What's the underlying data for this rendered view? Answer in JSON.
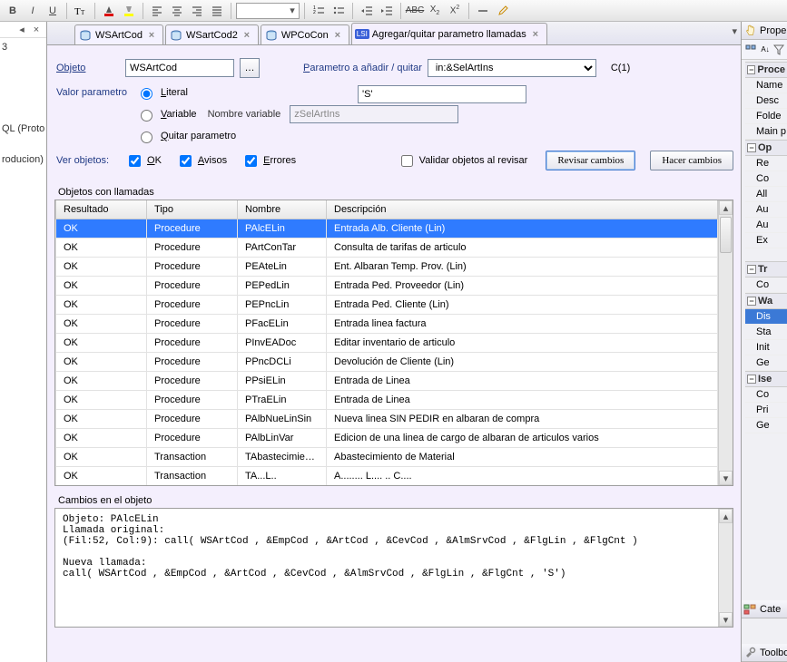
{
  "toolbar": {
    "bold": "B",
    "italic": "I",
    "underline": "U"
  },
  "left_panel": {
    "items": [
      "3",
      "QL (Prototip",
      "",
      "roducion)"
    ]
  },
  "tabs": [
    {
      "label": "WSArtCod",
      "icon": "db",
      "active": false
    },
    {
      "label": "WSartCod2",
      "icon": "db",
      "active": false
    },
    {
      "label": "WPCoCon",
      "icon": "db",
      "active": false
    },
    {
      "label": "Agregar/quitar parametro llamadas",
      "icon": "lsi",
      "active": true
    }
  ],
  "form": {
    "objeto_label": "Objeto",
    "objeto_value": "WSArtCod",
    "parametro_label": "Parametro a añadir / quitar",
    "parametro_value": "in:&SelArtIns",
    "c_label": "C(1)",
    "valor_label": "Valor parametro",
    "literal_label": "Literal",
    "literal_value": "'S'",
    "variable_label": "Variable",
    "nombre_var_label": "Nombre variable",
    "nombre_var_value": "zSelArtIns",
    "quitar_label": "Quitar parametro",
    "ver_objetos_label": "Ver objetos:",
    "ok_label": "OK",
    "avisos_label": "Avisos",
    "errores_label": "Errores",
    "validar_label": "Validar objetos al revisar",
    "revisar_btn": "Revisar cambios",
    "hacer_btn": "Hacer cambios"
  },
  "grid": {
    "header": "Objetos con llamadas",
    "columns": [
      "Resultado",
      "Tipo",
      "Nombre",
      "Descripción"
    ],
    "rows": [
      {
        "r": "OK",
        "t": "Procedure",
        "n": "PAlcELin",
        "d": "Entrada Alb. Cliente (Lin)",
        "sel": true
      },
      {
        "r": "OK",
        "t": "Procedure",
        "n": "PArtConTar",
        "d": "Consulta de tarifas de articulo"
      },
      {
        "r": "OK",
        "t": "Procedure",
        "n": "PEAteLin",
        "d": "Ent. Albaran Temp. Prov. (Lin)"
      },
      {
        "r": "OK",
        "t": "Procedure",
        "n": "PEPedLin",
        "d": "Entrada Ped. Proveedor (Lin)"
      },
      {
        "r": "OK",
        "t": "Procedure",
        "n": "PEPncLin",
        "d": "Entrada Ped. Cliente (Lin)"
      },
      {
        "r": "OK",
        "t": "Procedure",
        "n": "PFacELin",
        "d": "Entrada linea factura"
      },
      {
        "r": "OK",
        "t": "Procedure",
        "n": "PInvEADoc",
        "d": "Editar inventario de articulo"
      },
      {
        "r": "OK",
        "t": "Procedure",
        "n": "PPncDCLi",
        "d": "Devolución de Cliente (Lin)"
      },
      {
        "r": "OK",
        "t": "Procedure",
        "n": "PPsiELin",
        "d": "Entrada de Linea"
      },
      {
        "r": "OK",
        "t": "Procedure",
        "n": "PTraELin",
        "d": "Entrada de Linea"
      },
      {
        "r": "OK",
        "t": "Procedure",
        "n": "PAlbNueLinSin",
        "d": "Nueva linea SIN PEDIR en albaran de compra"
      },
      {
        "r": "OK",
        "t": "Procedure",
        "n": "PAlbLinVar",
        "d": "Edicion de una linea de cargo de albaran de articulos varios"
      },
      {
        "r": "OK",
        "t": "Transaction",
        "n": "TAbastecimiento",
        "d": "Abastecimiento de Material"
      },
      {
        "r": "OK",
        "t": "Transaction",
        "n": "TA...L..",
        "d": "A........  L.... .. C...."
      }
    ]
  },
  "changes": {
    "header": "Cambios en el objeto",
    "text": "Objeto: PAlcELin\nLlamada original:\n(Fil:52, Col:9): call( WSArtCod , &EmpCod , &ArtCod , &CevCod , &AlmSrvCod , &FlgLin , &FlgCnt )\n\nNueva llamada:\ncall( WSArtCod , &EmpCod , &ArtCod , &CevCod , &AlmSrvCod , &FlgLin , &FlgCnt , 'S')"
  },
  "right": {
    "properties": "Propert",
    "proc_group": "Proce",
    "items1": [
      "Name",
      "Desc",
      "Folde",
      "Main p"
    ],
    "op_group": "Op",
    "items2": [
      "Re",
      "Co",
      "All",
      "Au",
      "Au",
      "Ex"
    ],
    "tr_group": "Tr",
    "items3": [
      "Co"
    ],
    "wa_group": "Wa",
    "items4": [
      "Dis",
      "Sta",
      "Init",
      "Ge"
    ],
    "ise_group": "Ise",
    "items5": [
      "Co",
      "Pri",
      "Ge"
    ],
    "cat_header": "Cate",
    "toolbox": "Toolbo"
  }
}
